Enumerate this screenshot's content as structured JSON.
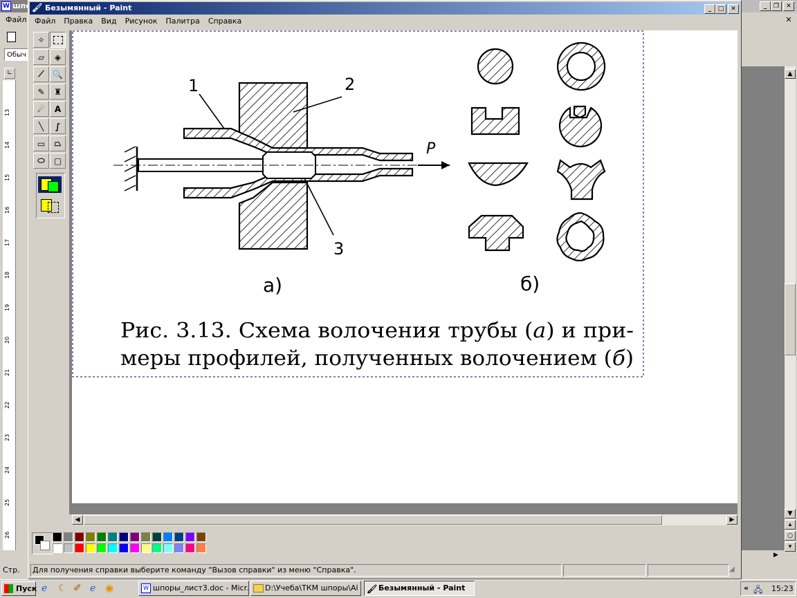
{
  "bg_window": {
    "title": "шпоры",
    "menu_first": "Файл",
    "style_box": "Обыч",
    "status_page": "Стр.",
    "ruler_numbers": [
      "13",
      "14",
      "15",
      "16",
      "17",
      "18",
      "19",
      "20",
      "21",
      "22",
      "23",
      "24",
      "25",
      "26"
    ]
  },
  "paint": {
    "title": "Безымянный - Paint",
    "menu": [
      "Файл",
      "Правка",
      "Вид",
      "Рисунок",
      "Палитра",
      "Справка"
    ],
    "status_text": "Для получения справки выберите команду \"Вызов справки\" из меню \"Справка\".",
    "palette": [
      "#000000",
      "#808080",
      "#800000",
      "#808000",
      "#008000",
      "#008080",
      "#000080",
      "#800080",
      "#808040",
      "#004040",
      "#0080ff",
      "#004080",
      "#8000ff",
      "#804000",
      "#ffffff",
      "#c0c0c0",
      "#ff0000",
      "#ffff00",
      "#00ff00",
      "#00ffff",
      "#0000ff",
      "#ff00ff",
      "#ffff80",
      "#00ff80",
      "#80ffff",
      "#8080ff",
      "#ff0080",
      "#ff8040"
    ]
  },
  "figure": {
    "label_1": "1",
    "label_2": "2",
    "label_3": "3",
    "label_p": "P",
    "label_a": "а)",
    "label_b": "б)",
    "caption_line1": "Рис. 3.13. Схема волочения трубы (",
    "caption_a": "а",
    "caption_line1_end": ") и при-",
    "caption_line2": "меры профилей, полученных волочением (",
    "caption_b": "б",
    "caption_line2_end": ")"
  },
  "taskbar": {
    "start": "Пуск",
    "items": [
      "шпоры_лист3.doc - Micr...",
      "D:\\Учеба\\ТКМ шпоры\\Al",
      "Безымянный - Paint"
    ],
    "clock": "15:23"
  }
}
